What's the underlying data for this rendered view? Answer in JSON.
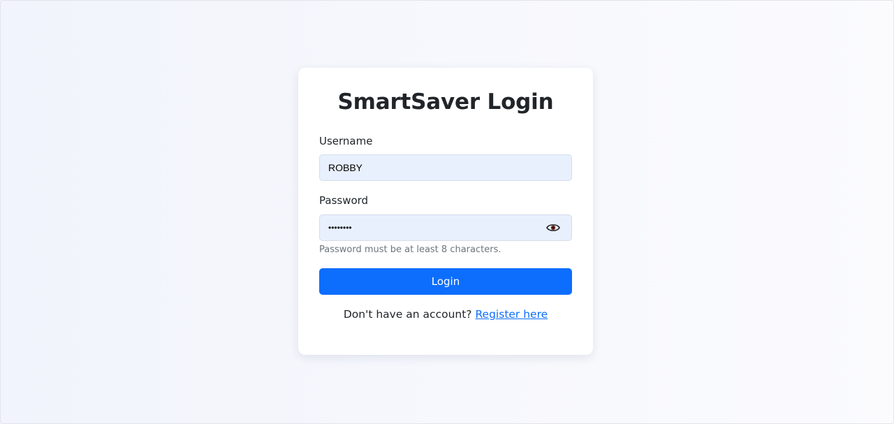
{
  "login": {
    "title": "SmartSaver Login",
    "username_label": "Username",
    "username_value": "ROBBY",
    "password_label": "Password",
    "password_value": "••••••••",
    "password_hint": "Password must be at least 8 characters.",
    "login_button": "Login",
    "register_prompt": "Don't have an account?",
    "register_link": "Register here"
  },
  "icons": {
    "toggle_password": "eye-icon"
  },
  "colors": {
    "primary": "#0d6efd",
    "input_background": "#e8f0fe",
    "text": "#212529",
    "muted": "#6c757d"
  }
}
